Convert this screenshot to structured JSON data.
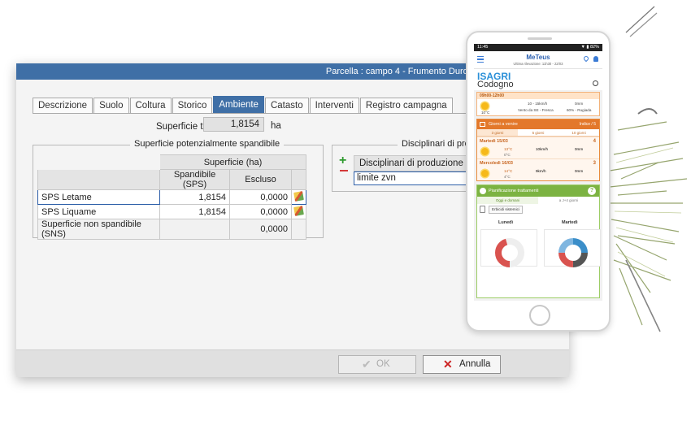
{
  "window": {
    "title": "Parcella : campo 4  - Frumento Duro In",
    "tabs": [
      "Descrizione",
      "Suolo",
      "Coltura",
      "Storico",
      "Ambiente",
      "Catasto",
      "Interventi",
      "Registro campagna"
    ],
    "active_tab": "Ambiente",
    "superficie_totale": {
      "label": "Superficie totale",
      "value": "1,8154",
      "unit": "ha"
    },
    "group_sps": {
      "title": "Superficie potenzialmente spandibile",
      "header_group": "Superficie (ha)",
      "col_spandibile": "Spandibile (SPS)",
      "col_escluso": "Escluso",
      "rows": [
        {
          "name": "SPS Letame",
          "spandibile": "1,8154",
          "escluso": "0,0000"
        },
        {
          "name": "SPS Liquame",
          "spandibile": "1,8154",
          "escluso": "0,0000"
        }
      ],
      "non_spandibile": {
        "name": "Superficie non spandibile (SNS)",
        "escluso": "0,0000"
      }
    },
    "group_disciplinari": {
      "title": "Disciplinari di prod",
      "column": "Disciplinari di produzione",
      "row": "limite zvn"
    },
    "buttons": {
      "ok": "OK",
      "cancel": "Annulla"
    }
  },
  "phone": {
    "status_time": "11:45",
    "status_right": "▼ ▮ 82%",
    "app_logo": "MeTeus",
    "app_sub": "Ultima rilevazione: 11h30 - 22/03",
    "brand": "ISAGRI",
    "location": "Codogno",
    "forecast_slot": "09h00-12h00",
    "forecast_temp": "10°C",
    "forecast_wind": "10 - 15km/h",
    "forecast_wind_dir": "Vento da SE - Fresca",
    "forecast_rain": "0mm",
    "forecast_hum": "60% - Rugiada",
    "days_title": "Giorni a venire",
    "days_index": "Indice / 5",
    "days_tabs": [
      "3 giorni",
      "5 giorni",
      "10 giorni"
    ],
    "day1": {
      "name": "Martedì 15/03",
      "num": "4",
      "tmax": "13°C",
      "tmin": "0°C",
      "wind": "10km/h",
      "rain": "0mm"
    },
    "day2": {
      "name": "Mercoledì 16/03",
      "num": "3",
      "tmax": "14°C",
      "tmin": "4°C",
      "wind": "9km/h",
      "rain": "0mm"
    },
    "plan_title": "Pianificazione trattamenti",
    "plan_tabs": [
      "Oggi e domani",
      "a J+4 giorni"
    ],
    "erb_label": "Erbicidi sistemici",
    "day_left": "Lunedì",
    "day_right": "Martedì"
  }
}
